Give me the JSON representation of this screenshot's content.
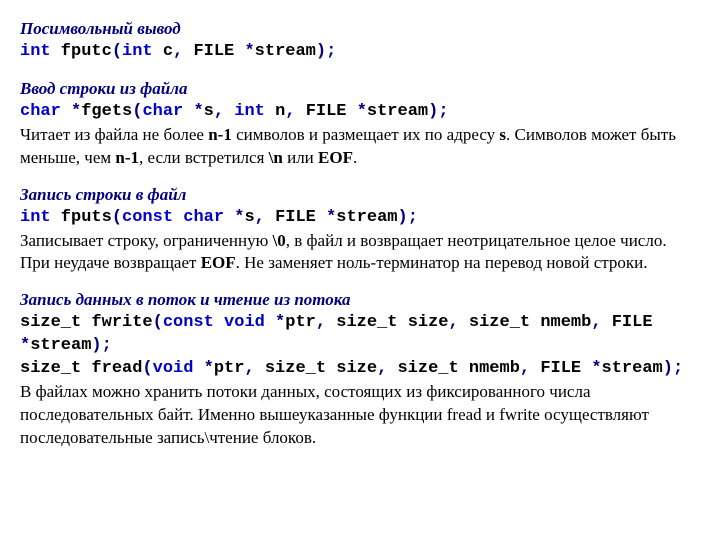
{
  "s1": {
    "heading": "Посимвольный вывод",
    "code": {
      "t1": "int",
      "t2": " fputc",
      "t3": "(",
      "t4": "int",
      "t5": " c",
      "t6": ", ",
      "t7": "FILE ",
      "t8": "*",
      "t9": "stream",
      "t10": ");"
    }
  },
  "s2": {
    "heading": "Ввод строки из файла",
    "code": {
      "t1": "char",
      "t2": " *",
      "t3": "fgets",
      "t4": "(",
      "t5": "char",
      "t6": " *",
      "t7": "s",
      "t8": ", ",
      "t9": "int",
      "t10": " n",
      "t11": ", ",
      "t12": "FILE ",
      "t13": "*",
      "t14": "stream",
      "t15": ");"
    },
    "desc": {
      "p1a": "Читает из файла не более ",
      "p1b": "n-1",
      "p1c": " символов и размещает их по адресу ",
      "p1d": "s",
      "p1e": ". Символов может быть меньше, чем ",
      "p1f": "n-1",
      "p1g": ", если встретился ",
      "p1h": "\\n",
      "p1i": " или ",
      "p1j": "EOF",
      "p1k": "."
    }
  },
  "s3": {
    "heading": "Запись строки в файл",
    "code": {
      "t1": "int",
      "t2": " fputs",
      "t3": "(",
      "t4": "const char",
      "t5": " *",
      "t6": "s",
      "t7": ", ",
      "t8": "FILE ",
      "t9": "*",
      "t10": "stream",
      "t11": ");"
    },
    "desc": {
      "p1a": "Записывает строку, ограниченную ",
      "p1b": "\\0",
      "p1c": ", в файл и возвращает неотрицательное целое число. При неудаче возвращает ",
      "p1d": "EOF",
      "p1e": ". Не заменяет ноль-терминатор на перевод новой строки."
    }
  },
  "s4": {
    "heading": "Запись данных в поток и чтение из потока",
    "code1": {
      "t1": "size_t fwrite",
      "t2": "(",
      "t3": "const void",
      "t4": " *",
      "t5": "ptr",
      "t6": ", ",
      "t7": "size_t size",
      "t8": ", ",
      "t9": "size_t nmemb",
      "t10": ", ",
      "t11": "FILE ",
      "t12": "*",
      "t13": "stream",
      "t14": ");"
    },
    "code2": {
      "t1": "size_t fread",
      "t2": "(",
      "t3": "void",
      "t4": " *",
      "t5": "ptr",
      "t6": ", ",
      "t7": "size_t size",
      "t8": ", ",
      "t9": "size_t nmemb",
      "t10": ", ",
      "t11": "FILE ",
      "t12": "*",
      "t13": "stream",
      "t14": ");"
    },
    "desc": "В файлах можно хранить потоки данных, состоящих из фиксированного числа последовательных байт. Именно вышеуказанные функции fread и fwrite осуществляют последовательные запись\\чтение блоков."
  }
}
